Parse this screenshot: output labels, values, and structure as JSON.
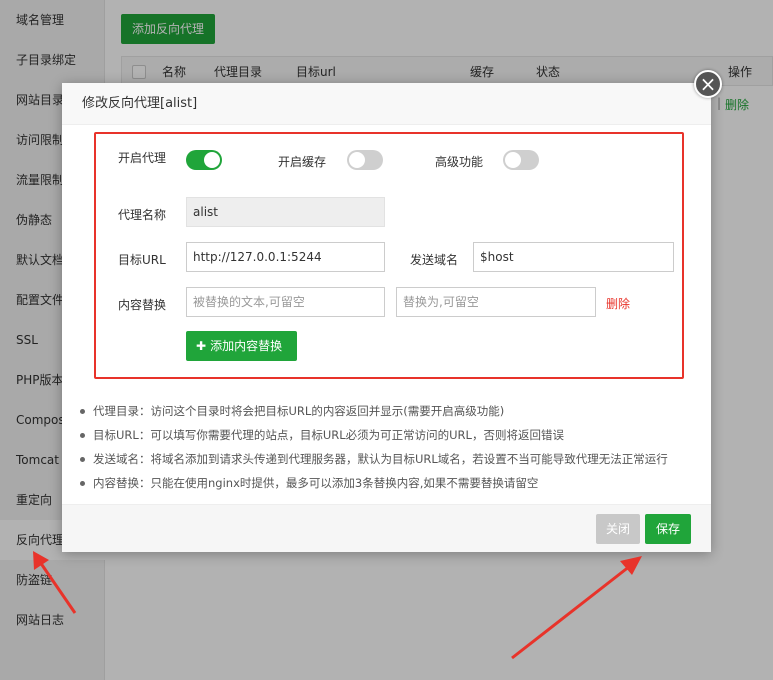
{
  "sidebar": {
    "items": [
      "域名管理",
      "子目录绑定",
      "网站目录",
      "访问限制",
      "流量限制",
      "伪静态",
      "默认文档",
      "配置文件",
      "SSL",
      "PHP版本",
      "Composer",
      "Tomcat",
      "重定向",
      "反向代理",
      "防盗链",
      "网站日志"
    ],
    "active_index": 13
  },
  "main": {
    "add_proxy_label": "添加反向代理",
    "table_headers": [
      "名称",
      "代理目录",
      "目标url",
      "缓存",
      "状态",
      "操作"
    ],
    "row_delete_label": "删除",
    "row_separator": "|"
  },
  "modal": {
    "title": "修改反向代理[alist]",
    "close_icon": "×",
    "enable_proxy_label": "开启代理",
    "enable_proxy_on": true,
    "enable_cache_label": "开启缓存",
    "enable_cache_on": false,
    "advanced_label": "高级功能",
    "advanced_on": false,
    "proxy_name_label": "代理名称",
    "proxy_name_value": "alist",
    "target_url_label": "目标URL",
    "target_url_value": "http://127.0.0.1:5244",
    "send_domain_label": "发送域名",
    "send_domain_value": "$host",
    "content_replace_label": "内容替换",
    "replace_from_placeholder": "被替换的文本,可留空",
    "replace_to_placeholder": "替换为,可留空",
    "delete_label": "删除",
    "add_content_replace_label": "添加内容替换",
    "tips": [
      "代理目录：访问这个目录时将会把目标URL的内容返回并显示(需要开启高级功能)",
      "目标URL：可以填写你需要代理的站点，目标URL必须为可正常访问的URL，否则将返回错误",
      "发送域名：将域名添加到请求头传递到代理服务器，默认为目标URL域名，若设置不当可能导致代理无法正常运行",
      "内容替换：只能在使用nginx时提供，最多可以添加3条替换内容,如果不需要替换请留空"
    ],
    "close_button_label": "关闭",
    "save_button_label": "保存"
  },
  "colors": {
    "accent": "#20a53a",
    "highlight_red": "#e8332a",
    "disabled_button": "#c8c8c8"
  }
}
